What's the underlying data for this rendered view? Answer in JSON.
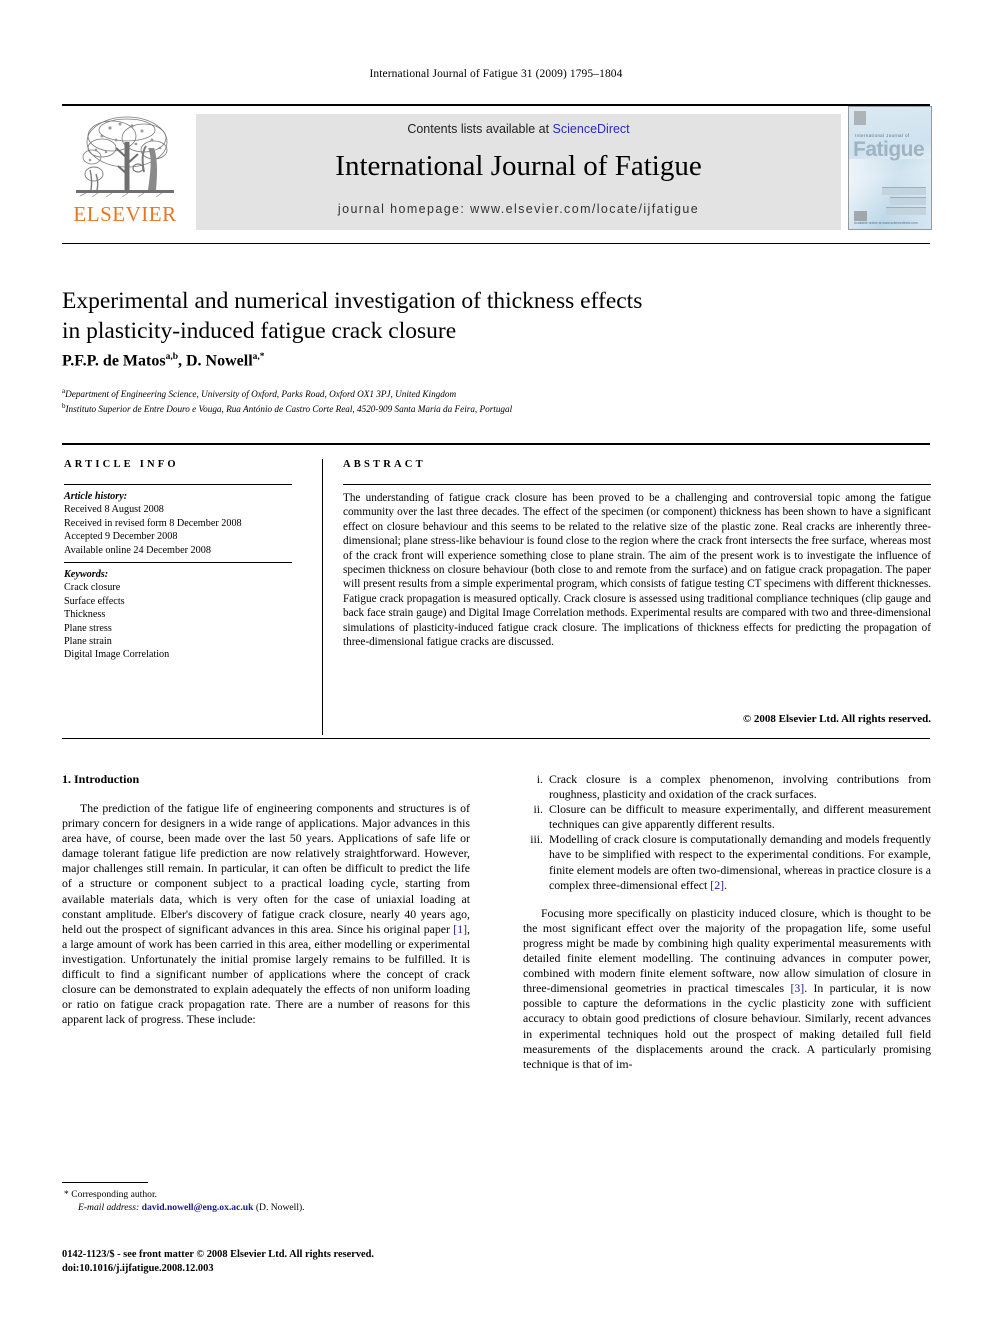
{
  "running_header": "International Journal of Fatigue 31 (2009) 1795–1804",
  "masthead": {
    "contents_prefix": "Contents lists available at ",
    "sciencedirect": "ScienceDirect",
    "journal_title": "International Journal of Fatigue",
    "homepage": "journal homepage: www.elsevier.com/locate/ijfatigue",
    "publisher_logo_text": "ELSEVIER",
    "cover": {
      "subtitle": "International Journal of",
      "title": "Fatigue",
      "footer": "Available online at www.sciencedirect.com"
    }
  },
  "article": {
    "title_line1": "Experimental and numerical investigation of thickness effects",
    "title_line2": "in plasticity-induced fatigue crack closure",
    "authors": "P.F.P. de Matos",
    "author_sup_1": "a,b",
    "authors_2": ", D. Nowell",
    "author_sup_2": "a,*",
    "affiliation_a": "Department of Engineering Science, University of Oxford, Parks Road, Oxford OX1 3PJ, United Kingdom",
    "affiliation_b": "Instituto Superior de Entre Douro e Vouga, Rua António de Castro Corte Real, 4520-909 Santa Maria da Feira, Portugal"
  },
  "info": {
    "heading": "ARTICLE INFO",
    "history_label": "Article history:",
    "history": [
      "Received 8 August 2008",
      "Received in revised form 8 December 2008",
      "Accepted 9 December 2008",
      "Available online 24 December 2008"
    ],
    "keywords_label": "Keywords:",
    "keywords": [
      "Crack closure",
      "Surface effects",
      "Thickness",
      "Plane stress",
      "Plane strain",
      "Digital Image Correlation"
    ]
  },
  "abstract": {
    "heading": "ABSTRACT",
    "text": "The understanding of fatigue crack closure has been proved to be a challenging and controversial topic among the fatigue community over the last three decades. The effect of the specimen (or component) thickness has been shown to have a significant effect on closure behaviour and this seems to be related to the relative size of the plastic zone. Real cracks are inherently three-dimensional; plane stress-like behaviour is found close to the region where the crack front intersects the free surface, whereas most of the crack front will experience something close to plane strain. The aim of the present work is to investigate the influence of specimen thickness on closure behaviour (both close to and remote from the surface) and on fatigue crack propagation. The paper will present results from a simple experimental program, which consists of fatigue testing CT specimens with different thicknesses. Fatigue crack propagation is measured optically. Crack closure is assessed using traditional compliance techniques (clip gauge and back face strain gauge) and Digital Image Correlation methods. Experimental results are compared with two and three-dimensional simulations of plasticity-induced fatigue crack closure. The implications of thickness effects for predicting the propagation of three-dimensional fatigue cracks are discussed.",
    "copyright": "© 2008 Elsevier Ltd. All rights reserved."
  },
  "body": {
    "section_heading": "1. Introduction",
    "para1_a": "The prediction of the fatigue life of engineering components and structures is of primary concern for designers in a wide range of applications. Major advances in this area have, of course, been made over the last 50 years. Applications of safe life or damage tolerant fatigue life prediction are now relatively straightforward. However, major challenges still remain. In particular, it can often be difficult to predict the life of a structure or component subject to a practical loading cycle, starting from available materials data, which is very often for the case of uniaxial loading at constant amplitude. Elber's discovery of fatigue crack closure, nearly 40 years ago, held out the prospect of significant advances in this area. Since his original paper ",
    "ref1": "[1]",
    "para1_b": ", a large amount of work has been carried in this area, either modelling or experimental investigation. Unfortunately the initial promise largely remains to be fulfilled. It is difficult to find a significant number of applications where the concept of crack closure can be demonstrated to explain adequately the effects of non uniform loading or ratio on fatigue crack propagation rate. There are a number of reasons for this apparent lack of progress. These include:",
    "list": [
      {
        "numeral": "i.",
        "text": "Crack closure is a complex phenomenon, involving contributions from roughness, plasticity and oxidation of the crack surfaces."
      },
      {
        "numeral": "ii.",
        "text": "Closure can be difficult to measure experimentally, and different measurement techniques can give apparently different results."
      },
      {
        "numeral": "iii.",
        "text": "Modelling of crack closure is computationally demanding and models frequently have to be simplified with respect to the experimental conditions. For example, finite element models are often two-dimensional, whereas in practice closure is a complex three-dimensional effect ",
        "ref": "[2]",
        "text_after": "."
      }
    ],
    "para2_a": "Focusing more specifically on plasticity induced closure, which is thought to be the most significant effect over the majority of the propagation life, some useful progress might be made by combining high quality experimental measurements with detailed finite element modelling. The continuing advances in computer power, combined with modern finite element software, now allow simulation of closure in three-dimensional geometries in practical timescales ",
    "ref3": "[3]",
    "para2_b": ". In particular, it is now possible to capture the deformations in the cyclic plasticity zone with sufficient accuracy to obtain good predictions of closure behaviour. Similarly, recent advances in experimental techniques hold out the prospect of making detailed full field measurements of the displacements around the crack. A particularly promising technique is that of im-"
  },
  "footnote": {
    "star": "*",
    "corresponding": "Corresponding author.",
    "email_label": "E-mail address:",
    "email": "david.nowell@eng.ox.ac.uk",
    "email_suffix": "(D. Nowell)."
  },
  "imprint": {
    "line1": "0142-1123/$ - see front matter © 2008 Elsevier Ltd. All rights reserved.",
    "line2": "doi:10.1016/j.ijfatigue.2008.12.003"
  }
}
